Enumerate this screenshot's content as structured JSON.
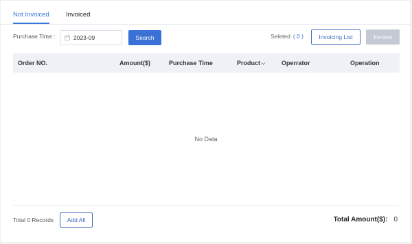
{
  "tabs": [
    {
      "label": "Not Invoiced",
      "active": true
    },
    {
      "label": "Invoiced",
      "active": false
    }
  ],
  "filter": {
    "label": "Purchase Time :",
    "date_value": "2023-09",
    "search_label": "Search"
  },
  "selection": {
    "label": "Seleted",
    "count": "( 0 )"
  },
  "actions": {
    "invoicing_list_label": "Invoicing List",
    "invoice_label": "Invoice"
  },
  "table": {
    "columns": [
      "Order NO.",
      "Amount($)",
      "Purchase Time",
      "Product",
      "Operrator",
      "Operation"
    ],
    "rows": [],
    "empty_text": "No Data"
  },
  "footer": {
    "total_records": "Total 0 Records",
    "add_all_label": "Add All",
    "total_amount_label": "Total Amount($):",
    "total_amount_value": "0"
  },
  "colors": {
    "accent": "#3a71d6",
    "disabled": "#c4c9d3",
    "header_bg": "#eef1f6"
  },
  "icons": {
    "calendar": "calendar-icon",
    "product_sort": "chevron-down-icon"
  }
}
